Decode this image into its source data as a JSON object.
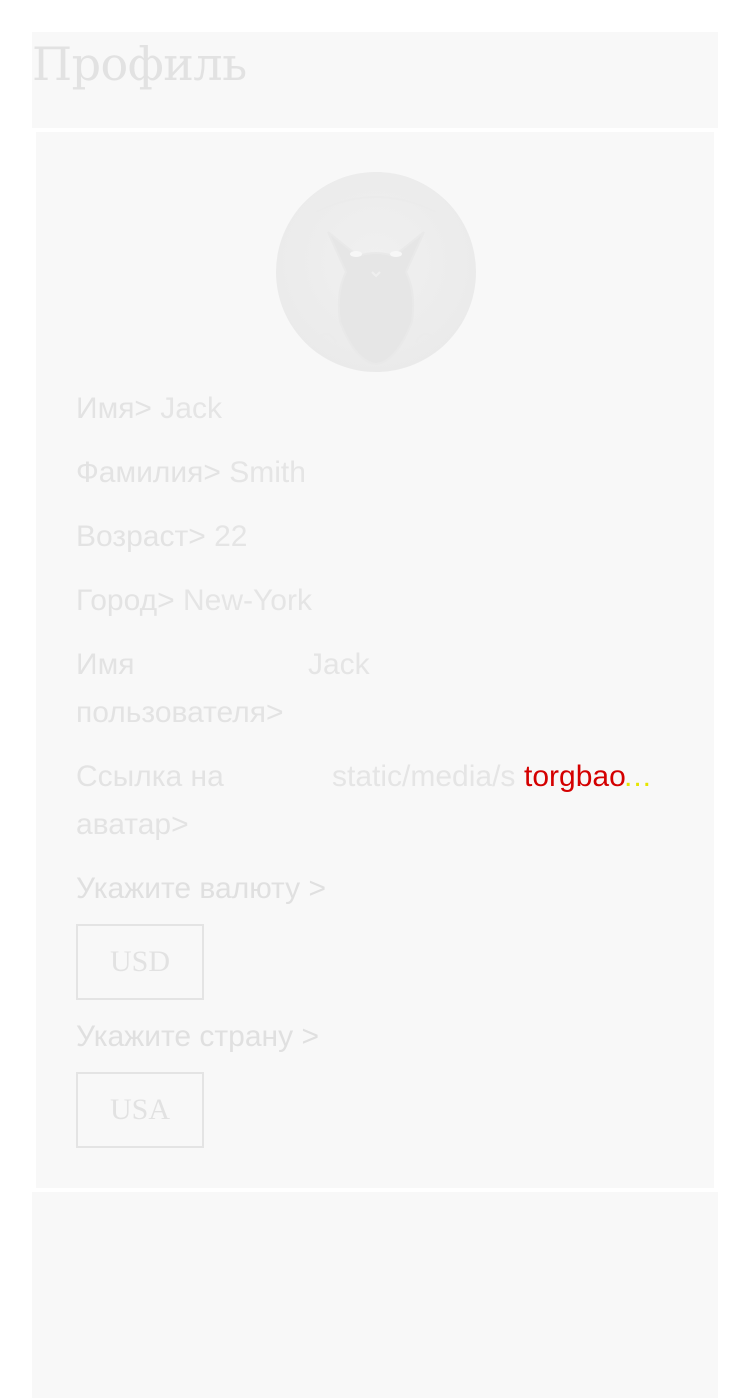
{
  "page": {
    "title": "Профиль"
  },
  "profile": {
    "avatar_icon": "black-cat-avatar",
    "fields": [
      {
        "label": "Имя>",
        "value": "Jack"
      },
      {
        "label": "Фамилия>",
        "value": "Smith"
      },
      {
        "label": "Возраст>",
        "value": "22"
      },
      {
        "label": "Город>",
        "value": "New-York"
      },
      {
        "label": "Имя пользователя>",
        "value": "Jack"
      }
    ],
    "avatar_link": {
      "label": "Ссылка на аватар>",
      "value": "static/media/s",
      "overlay_text": "torgbao",
      "ellipsis": "..."
    }
  },
  "currency": {
    "label": "Укажите валюту >",
    "selected": "USD"
  },
  "country": {
    "label": "Укажите страну >",
    "selected": "USA"
  },
  "colors": {
    "background": "#ffffff",
    "panel": "#f8f8f8",
    "text_faded": "#e2e2e2",
    "overlay_red": "#d40000",
    "overlay_yellow": "#e6e600"
  }
}
